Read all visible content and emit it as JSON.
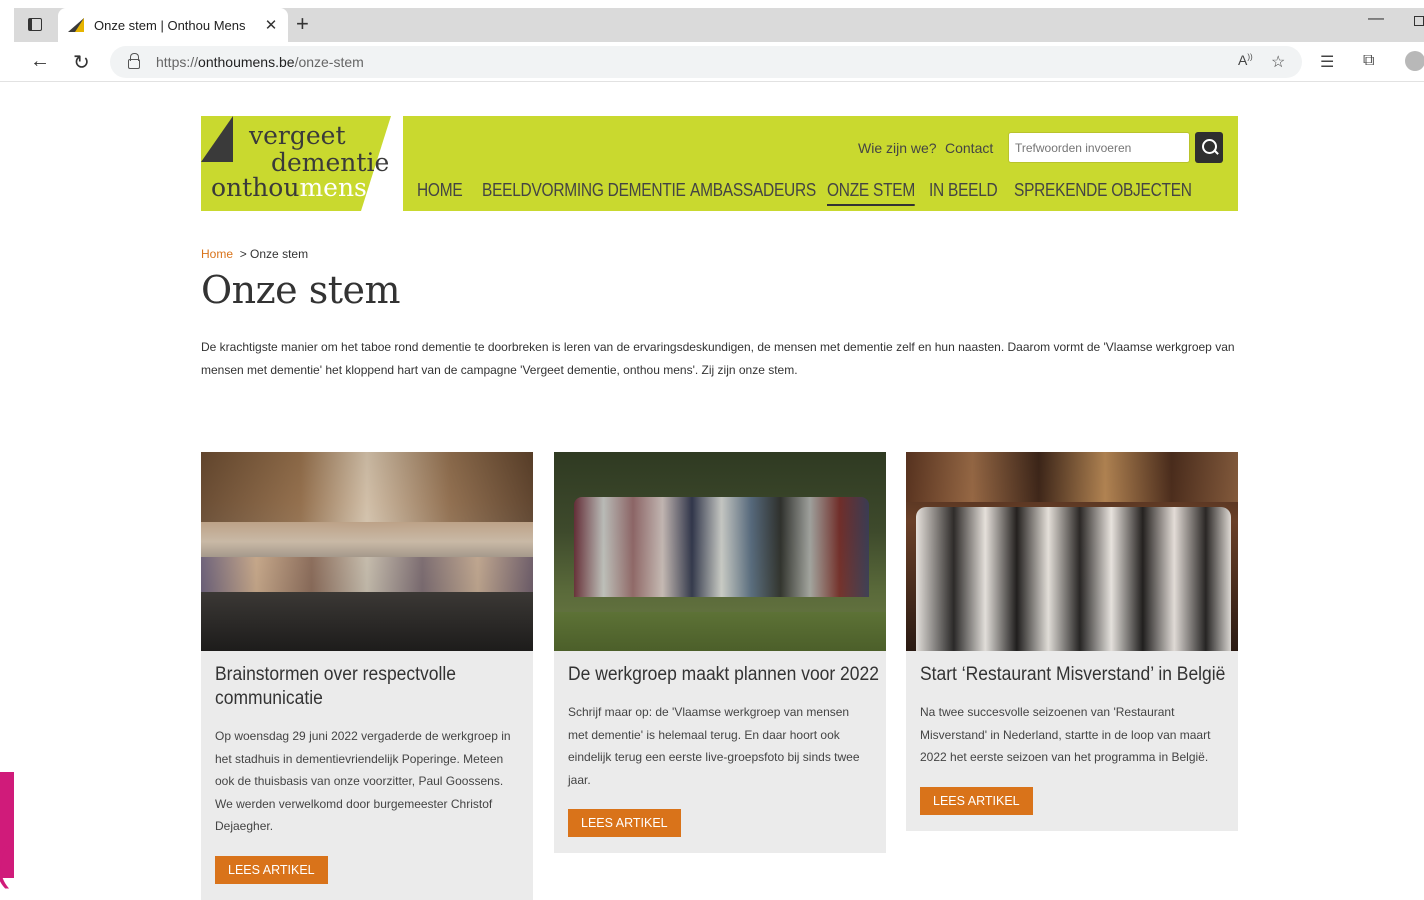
{
  "browser": {
    "tab_title": "Onze stem | Onthou Mens",
    "url_prefix": "https://",
    "url_domain": "onthoumens.be",
    "url_path": "/onze-stem"
  },
  "logo": {
    "line1": "vergeet",
    "line2": "dementie",
    "line3a": "onthou",
    "line3b": "mens",
    "color": "#c9d92f"
  },
  "header": {
    "top_links": [
      "Wie zijn we?",
      "Contact"
    ],
    "search_placeholder": "Trefwoorden invoeren",
    "nav": [
      "HOME",
      "BEELDVORMING DEMENTIE",
      "AMBASSADEURS",
      "ONZE STEM",
      "IN BEELD",
      "SPREKENDE OBJECTEN"
    ],
    "active_nav": "ONZE STEM"
  },
  "breadcrumb": {
    "home": "Home",
    "separator": ">",
    "current": "Onze stem"
  },
  "page": {
    "title": "Onze stem",
    "intro": "De krachtigste manier om het taboe rond dementie te doorbreken is leren van de ervaringsdeskundigen, de mensen met dementie zelf en hun naasten. Daarom vormt de 'Vlaamse werkgroep van mensen met dementie' het kloppend hart van de campagne 'Vergeet dementie, onthou mens'. Zij zijn onze stem."
  },
  "cards": [
    {
      "title": "Brainstormen over respectvolle communicatie",
      "text": "Op woensdag 29 juni 2022 vergaderde de werkgroep in het stadhuis in dementievriendelijk Poperinge. Meteen ook de thuisbasis van onze voorzitter, Paul Goossens. We werden verwelkomd door burgemeester Christof Dejaegher.",
      "button": "LEES ARTIKEL"
    },
    {
      "title": "De werkgroep maakt plannen voor 2022",
      "text": "Schrijf maar op: de 'Vlaamse werkgroep van mensen met dementie' is helemaal terug. En daar hoort ook eindelijk terug een eerste live-groepsfoto bij sinds twee jaar.",
      "button": "LEES ARTIKEL"
    },
    {
      "title": "Start ‘Restaurant Misverstand’ in België",
      "text": "Na twee succesvolle seizoenen van 'Restaurant Misverstand' in Nederland, startte in de loop van maart 2022 het eerste seizoen van het programma in België.",
      "button": "LEES ARTIKEL"
    }
  ],
  "colors": {
    "accent": "#d9731a",
    "brand_green": "#c9d92f",
    "side_pink": "#d01b7a"
  }
}
